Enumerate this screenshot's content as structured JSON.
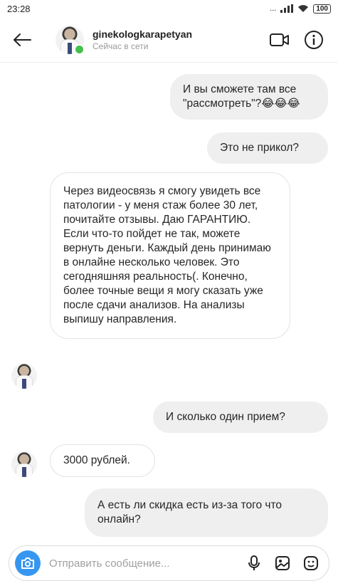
{
  "status_bar": {
    "time": "23:28",
    "dots": "...",
    "battery": "100"
  },
  "header": {
    "username": "ginekologkarapetyan",
    "status": "Сейчас в сети"
  },
  "messages": [
    {
      "direction": "outgoing",
      "text": "И вы сможете там все \"рассмотреть\"?😂😂😂"
    },
    {
      "direction": "outgoing",
      "text": "Это не прикол?"
    },
    {
      "direction": "incoming",
      "text": "Через видеосвязь я смогу увидеть все патологии - у меня стаж более 30 лет, почитайте отзывы. Даю ГАРАНТИЮ. Если что-то пойдет не так, можете вернуть деньги. Каждый день принимаю в онлайне несколько человек. Это сегодняшняя реальность(. Конечно, более точные вещи я могу сказать уже после сдачи анализов. На анализы выпишу направления."
    },
    {
      "direction": "outgoing",
      "text": "И сколько один прием?"
    },
    {
      "direction": "incoming",
      "text": "3000 рублей."
    },
    {
      "direction": "outgoing",
      "text": "А есть ли скидка есть из-за того что онлайн?"
    }
  ],
  "composer": {
    "placeholder": "Отправить сообщение..."
  },
  "colors": {
    "outgoing_bubble": "#efefef",
    "incoming_border": "#e3e3e3",
    "camera_button": "#3797f0",
    "online_dot": "#44c04c"
  },
  "icons": [
    "back-arrow-icon",
    "video-call-icon",
    "info-icon",
    "camera-icon",
    "microphone-icon",
    "gallery-icon",
    "sticker-icon"
  ]
}
